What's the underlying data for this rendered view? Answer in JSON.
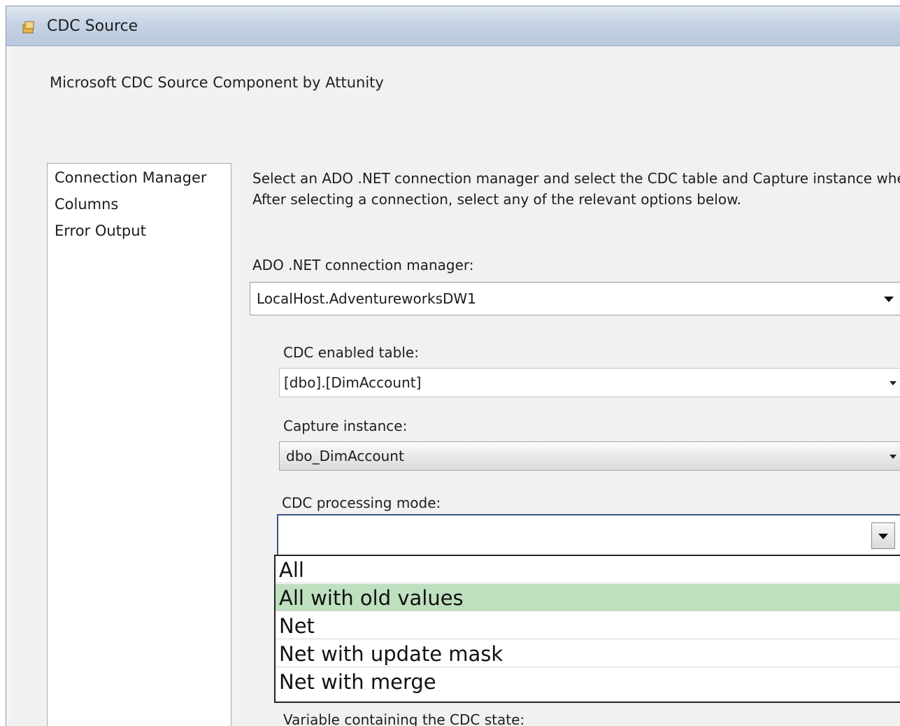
{
  "window": {
    "title": "CDC Source",
    "subtitle": "Microsoft CDC Source Component by Attunity"
  },
  "nav": {
    "items": [
      {
        "label": "Connection Manager"
      },
      {
        "label": "Columns"
      },
      {
        "label": "Error Output"
      }
    ]
  },
  "main": {
    "instructions_line1": "Select an ADO .NET connection manager and select the CDC table and Capture instance whe",
    "instructions_line2": "After selecting a connection, select any of the relevant options below.",
    "connection_manager": {
      "label": "ADO .NET connection manager:",
      "value": "LocalHost.AdventureworksDW1"
    },
    "cdc_table": {
      "label": "CDC enabled table:",
      "value": "[dbo].[DimAccount]"
    },
    "capture_instance": {
      "label": "Capture instance:",
      "value": "dbo_DimAccount"
    },
    "processing_mode": {
      "label": "CDC processing mode:",
      "value": "",
      "options": [
        "All",
        "All with old values",
        "Net",
        "Net with update mask",
        "Net with merge"
      ],
      "highlighted": "All with old values"
    },
    "state_variable": {
      "label": "Variable containing the CDC state:"
    }
  },
  "colors": {
    "highlight": "#bfe0bf",
    "titlebar": "#c6d3e4",
    "focus_border": "#3b5680"
  }
}
